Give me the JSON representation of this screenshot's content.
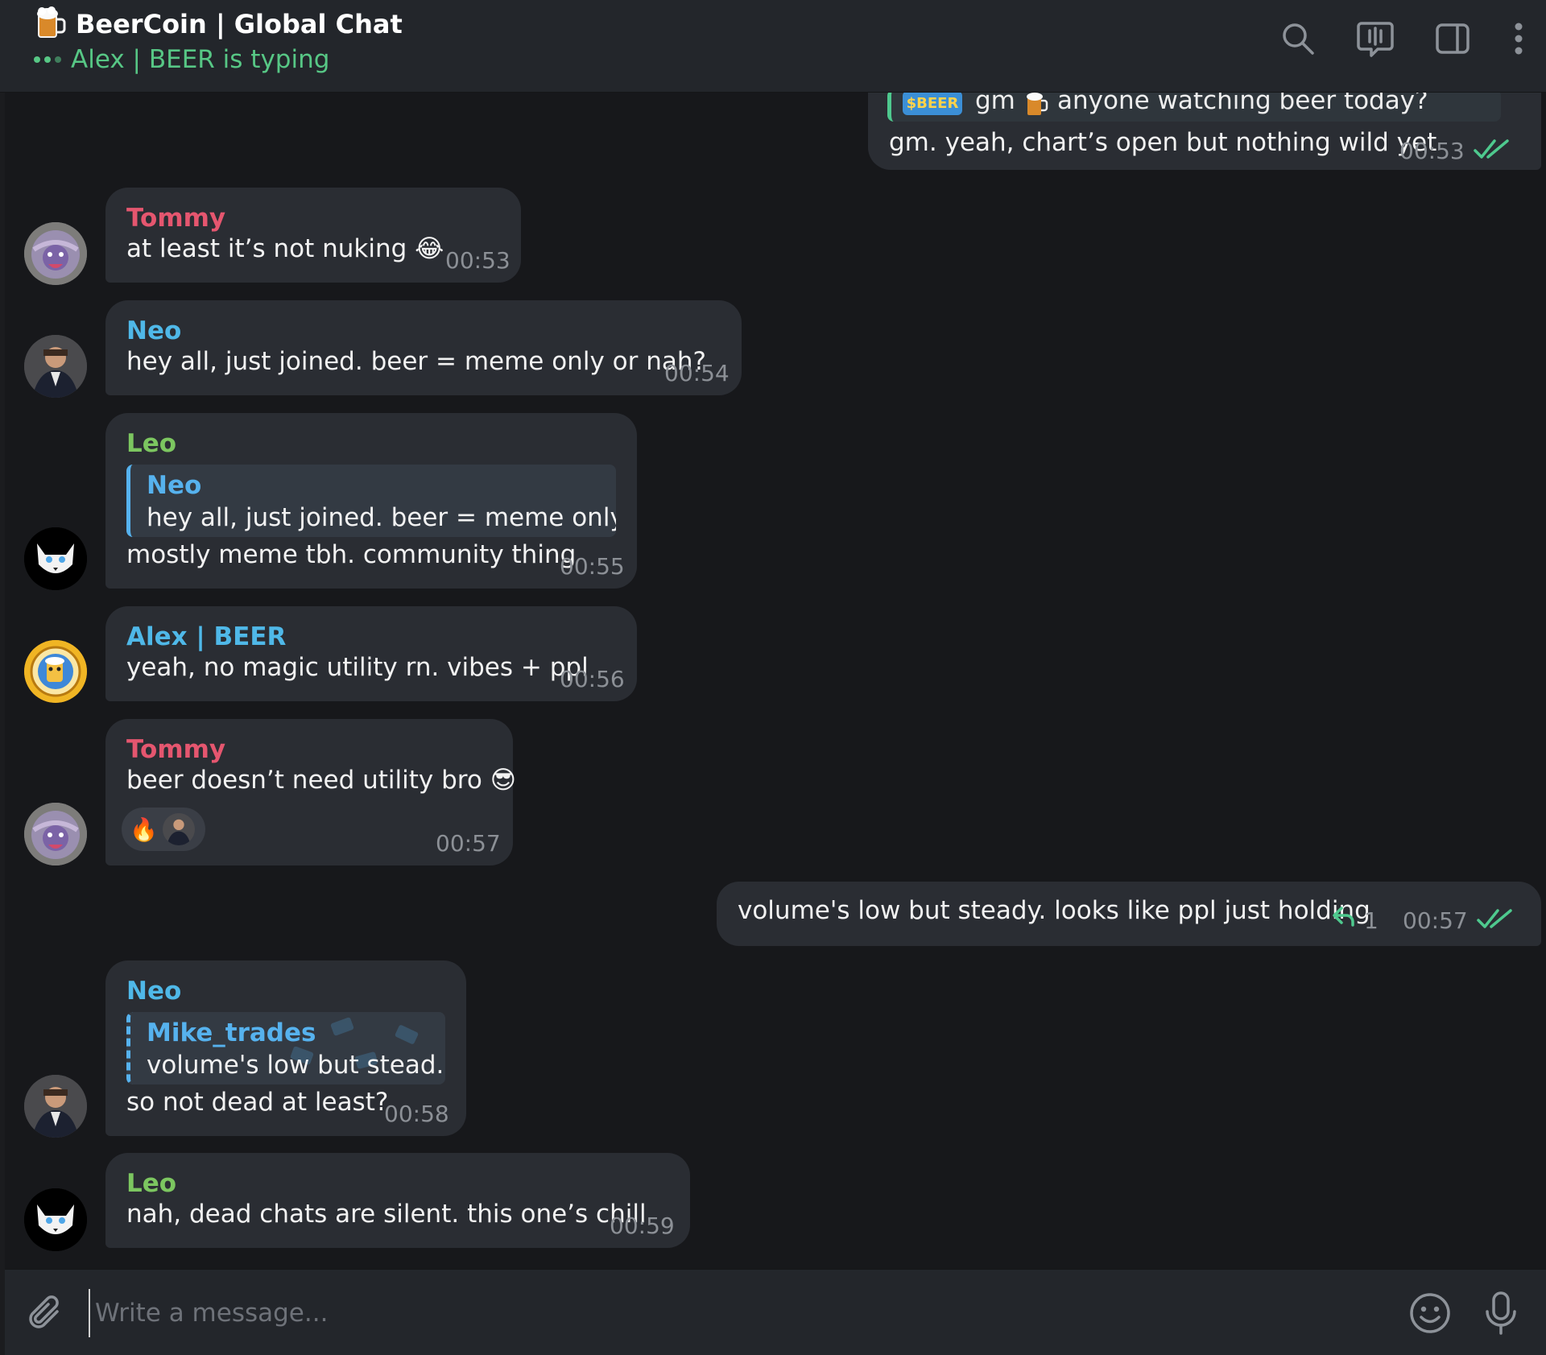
{
  "header": {
    "title": "BeerCoin | Global Chat",
    "status": "Alex | BEER is typing",
    "status_color": "#57c785",
    "icons": [
      "beer-mug-icon",
      "search-icon",
      "live-stream-icon",
      "sidebar-toggle-icon",
      "more-vertical-icon"
    ]
  },
  "colors": {
    "tommy": "#e5566f",
    "neo": "#4fb8e8",
    "leo": "#7cc660",
    "alex": "#4fb8e8",
    "check": "#4ec98e",
    "bubble": "#2a2d33"
  },
  "messages": {
    "m0": {
      "quote_badge": "$BEER",
      "quote_text_1": "gm",
      "quote_text_2": "anyone watching beer today?",
      "text": "gm. yeah, chart’s open but nothing wild yet",
      "time": "00:53",
      "outgoing": true
    },
    "m1": {
      "author": "Tommy",
      "text": "at least it’s not nuking",
      "emoji": "😂",
      "time": "00:53"
    },
    "m2": {
      "author": "Neo",
      "text": "hey all, just joined. beer = meme only or nah?",
      "time": "00:54"
    },
    "m3": {
      "author": "Leo",
      "reply_author": "Neo",
      "reply_text": "hey all, just joined. beer = meme only ...",
      "text": "mostly meme tbh. community thing",
      "time": "00:55"
    },
    "m4": {
      "author": "Alex | BEER",
      "text": "yeah, no magic utility rn. vibes + ppl",
      "time": "00:56"
    },
    "m5": {
      "author": "Tommy",
      "text": "beer doesn’t need utility bro",
      "emoji": "😎",
      "reaction_emoji": "🔥",
      "time": "00:57"
    },
    "m6": {
      "text": "volume's low but steady. looks like ppl just holding",
      "reply_count": "1",
      "time": "00:57",
      "outgoing": true
    },
    "m7": {
      "author": "Neo",
      "reply_author": "Mike_trades",
      "reply_text": "volume's low but stead...",
      "text": "so not dead at least?",
      "time": "00:58"
    },
    "m8": {
      "author": "Leo",
      "text": "nah, dead chats are silent. this one’s chill",
      "time": "00:59"
    }
  },
  "composer": {
    "placeholder": "Write a message...",
    "icons": [
      "paperclip-icon",
      "emoji-icon",
      "microphone-icon"
    ]
  }
}
